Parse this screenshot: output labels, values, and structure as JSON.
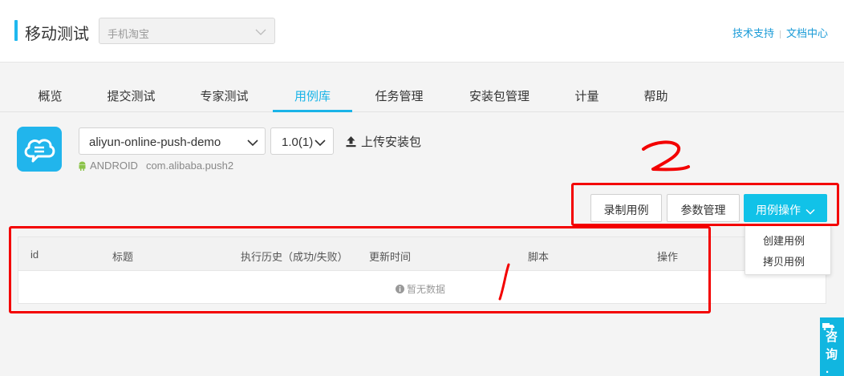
{
  "header": {
    "title": "移动测试",
    "app_select": {
      "value": "手机淘宝"
    },
    "links": [
      {
        "label": "技术支持"
      },
      {
        "label": "文档中心"
      }
    ]
  },
  "tabs": [
    {
      "label": "概览"
    },
    {
      "label": "提交测试"
    },
    {
      "label": "专家测试"
    },
    {
      "label": "用例库",
      "active": true
    },
    {
      "label": "任务管理"
    },
    {
      "label": "安装包管理"
    },
    {
      "label": "计量"
    },
    {
      "label": "帮助"
    }
  ],
  "app": {
    "package_select": {
      "value": "aliyun-online-push-demo"
    },
    "version_select": {
      "value": "1.0(1)"
    },
    "upload_label": "上传安装包",
    "platform": "ANDROID",
    "package_name": "com.alibaba.push2"
  },
  "actions": {
    "record_label": "录制用例",
    "params_label": "参数管理",
    "case_ops_label": "用例操作",
    "menu_items": [
      {
        "label": "创建用例"
      },
      {
        "label": "拷贝用例"
      }
    ]
  },
  "table": {
    "columns": [
      "id",
      "标题",
      "执行历史（成功/失败）",
      "更新时间",
      "脚本",
      "操作"
    ],
    "empty_text": "暂无数据"
  },
  "consult": {
    "label": "咨询·"
  },
  "colors": {
    "accent": "#1ab4e8",
    "annotation": "#f30000",
    "primary_button": "#11c2e8"
  },
  "icons": [
    "chevron-down-icon",
    "upload-icon",
    "android-icon",
    "info-icon",
    "cloud-chat-icon",
    "truck-icon"
  ]
}
